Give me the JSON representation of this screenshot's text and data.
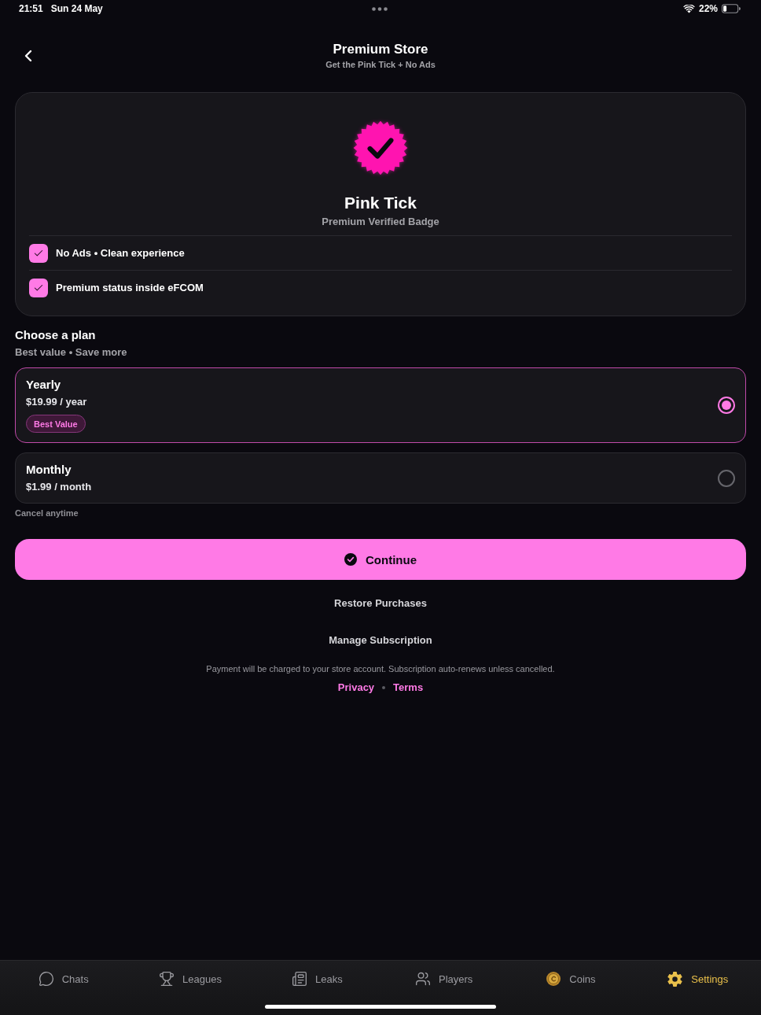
{
  "status_bar": {
    "time": "21:51",
    "date": "Sun 24 May",
    "battery": "22%"
  },
  "header": {
    "title": "Premium Store",
    "subtitle": "Get the Pink Tick + No Ads"
  },
  "product": {
    "title": "Pink Tick",
    "subtitle": "Premium Verified Badge",
    "features": [
      {
        "label": "No Ads • Clean experience",
        "checked": true
      },
      {
        "label": "Premium status inside eFCOM",
        "checked": true
      }
    ]
  },
  "plans": {
    "title": "Choose a plan",
    "subtitle": "Best value • Save more",
    "items": [
      {
        "name": "Yearly",
        "price": "$19.99 / year",
        "badge": "Best Value",
        "selected": true
      },
      {
        "name": "Monthly",
        "price": "$1.99 / month",
        "selected": false
      }
    ],
    "note": "Cancel anytime"
  },
  "continue_button": "Continue",
  "restore_link": "Restore Purchases",
  "manage_link": "Manage Subscription",
  "disclaimer": "Payment will be charged to your store account. Subscription auto-renews unless cancelled.",
  "legal_links": [
    "Privacy",
    "Terms"
  ],
  "tab_bar": [
    {
      "label": "Chats",
      "selected": false
    },
    {
      "label": "Leagues",
      "selected": false
    },
    {
      "label": "Leaks",
      "selected": false
    },
    {
      "label": "Players",
      "selected": false
    },
    {
      "label": "Coins",
      "selected": false
    },
    {
      "label": "Settings",
      "selected": true
    }
  ]
}
